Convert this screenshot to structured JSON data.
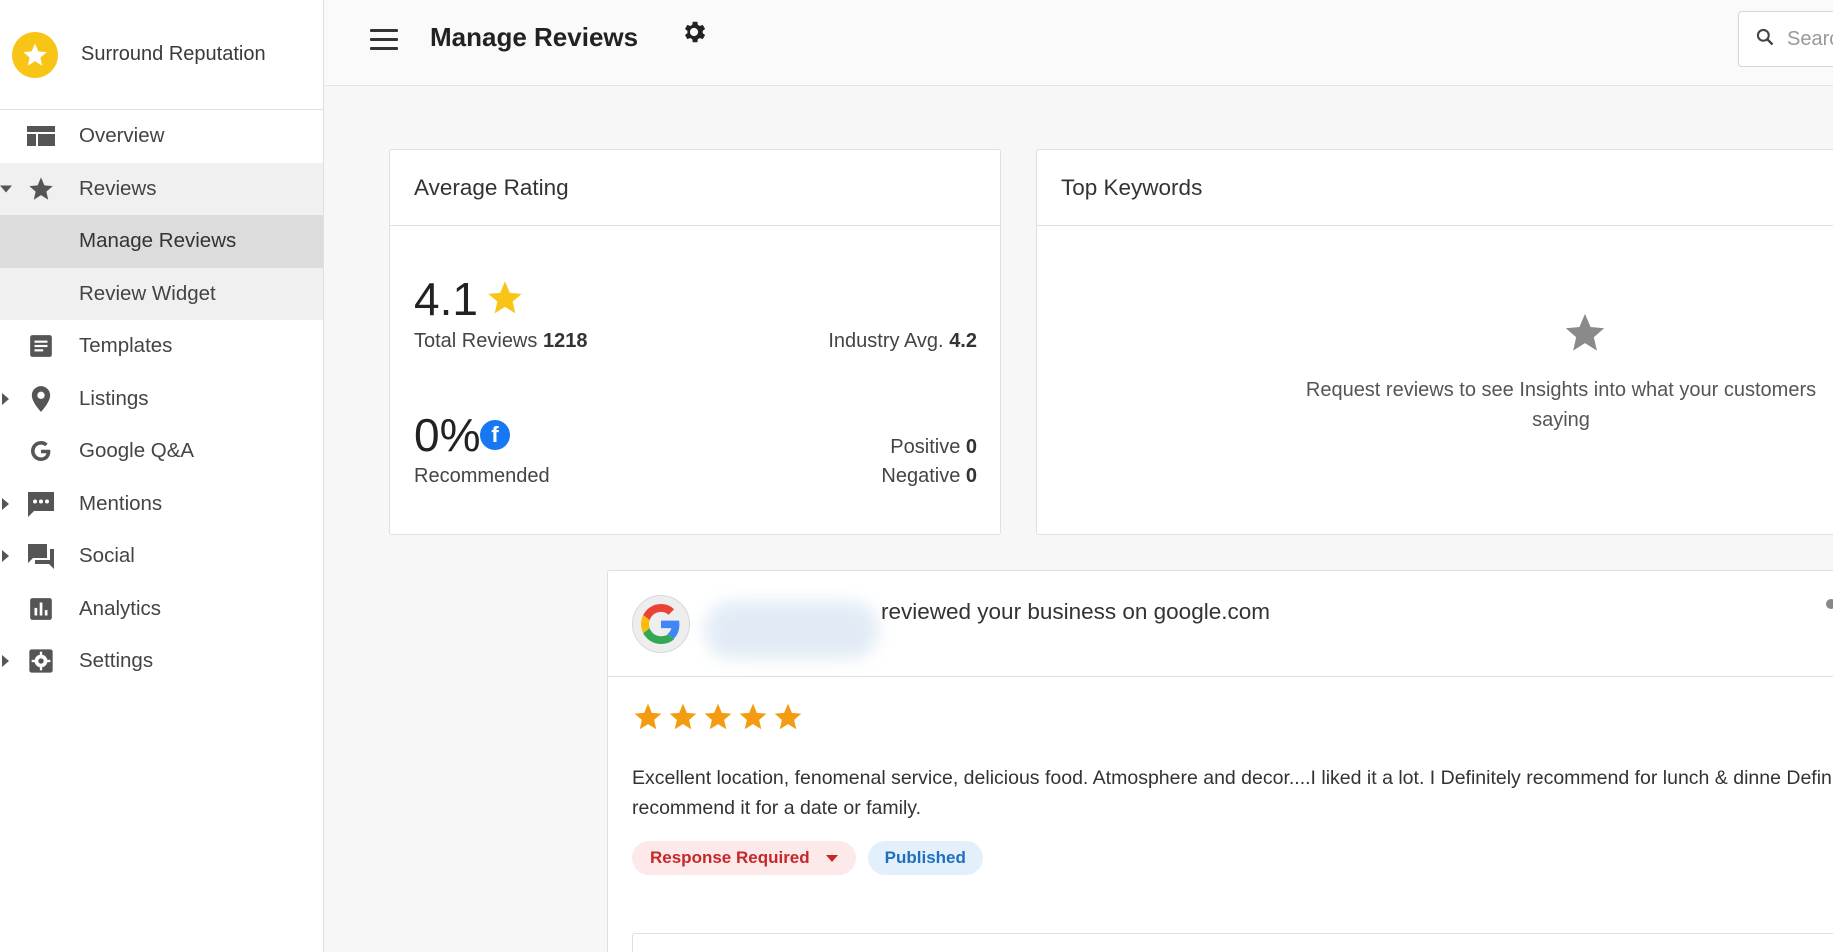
{
  "brand": {
    "name": "Surround Reputation"
  },
  "sidebar": {
    "items": [
      {
        "label": "Overview",
        "icon": "dashboard-icon"
      },
      {
        "label": "Reviews",
        "icon": "star-icon"
      },
      {
        "label": "Manage Reviews"
      },
      {
        "label": "Review Widget"
      },
      {
        "label": "Templates",
        "icon": "document-icon"
      },
      {
        "label": "Listings",
        "icon": "location-pin-icon"
      },
      {
        "label": "Google Q&A",
        "icon": "google-icon"
      },
      {
        "label": "Mentions",
        "icon": "chat-icon"
      },
      {
        "label": "Social",
        "icon": "forum-icon"
      },
      {
        "label": "Analytics",
        "icon": "bar-chart-icon"
      },
      {
        "label": "Settings",
        "icon": "settings-icon"
      }
    ]
  },
  "header": {
    "title": "Manage Reviews",
    "search_placeholder": "Search"
  },
  "rating_card": {
    "title": "Average Rating",
    "value": "4.1",
    "total_label": "Total Reviews",
    "total_value": "1218",
    "industry_label": "Industry Avg.",
    "industry_value": "4.2",
    "recommended_value": "0%",
    "recommended_label": "Recommended",
    "positive_label": "Positive",
    "positive_value": "0",
    "negative_label": "Negative",
    "negative_value": "0"
  },
  "keywords_card": {
    "title": "Top Keywords",
    "empty_message": "Request reviews to see Insights into what your customers saying"
  },
  "review": {
    "source_text": "reviewed your business on google.com",
    "stars": 5,
    "text": "Excellent location, fenomenal service, delicious food. Atmosphere and decor....I liked it a lot. I Definitely recommend for lunch & dinne Definitely recommend it for a date or family.",
    "status_label": "Response Required",
    "published_label": "Published"
  },
  "colors": {
    "brand_yellow": "#f8c517",
    "star_orange": "#f39c12",
    "status_red": "#c62828",
    "published_blue": "#1e6fbf",
    "facebook_blue": "#1877f2"
  }
}
